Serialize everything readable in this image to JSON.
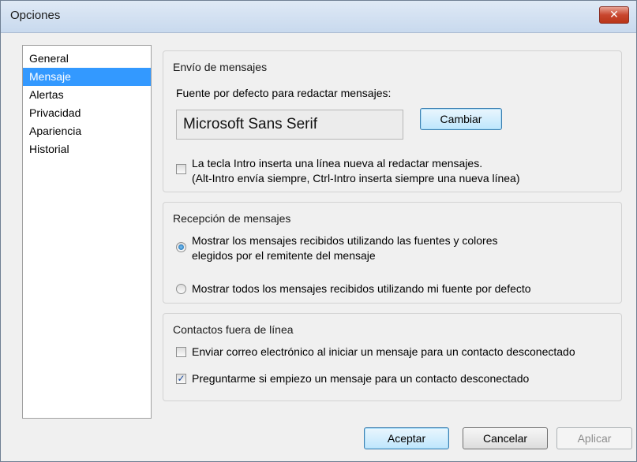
{
  "window": {
    "title": "Opciones",
    "close_glyph": "✕"
  },
  "sidebar": {
    "items": [
      {
        "label": "General"
      },
      {
        "label": "Mensaje"
      },
      {
        "label": "Alertas"
      },
      {
        "label": "Privacidad"
      },
      {
        "label": "Apariencia"
      },
      {
        "label": "Historial"
      }
    ],
    "selected": "Mensaje"
  },
  "envio": {
    "title": "Envío de mensajes",
    "font_label": "Fuente por defecto para redactar mensajes:",
    "font_value": "Microsoft Sans Serif",
    "change_button": "Cambiar",
    "enter_checkbox": {
      "checked": false,
      "line1": "La tecla Intro inserta una línea nueva al redactar mensajes.",
      "line2": "(Alt-Intro envía siempre, Ctrl-Intro inserta siempre una nueva línea)"
    }
  },
  "recepcion": {
    "title": "Recepción de mensajes",
    "option1_line1": "Mostrar los mensajes recibidos utilizando las fuentes y colores",
    "option1_line2": "elegidos por el remitente del mensaje",
    "option1_selected": true,
    "option2": "Mostrar todos los mensajes recibidos utilizando mi fuente por defecto",
    "option2_selected": false
  },
  "contactos": {
    "title": "Contactos fuera de línea",
    "email_checkbox": {
      "label": "Enviar correo electrónico al iniciar un mensaje para un contacto desconectado",
      "checked": false
    },
    "ask_checkbox": {
      "label": "Preguntarme si empiezo un mensaje para un contacto desconectado",
      "checked": true
    }
  },
  "footer": {
    "accept": "Aceptar",
    "cancel": "Cancelar",
    "apply": "Aplicar",
    "apply_enabled": false
  },
  "checkmark_glyph": "✓"
}
